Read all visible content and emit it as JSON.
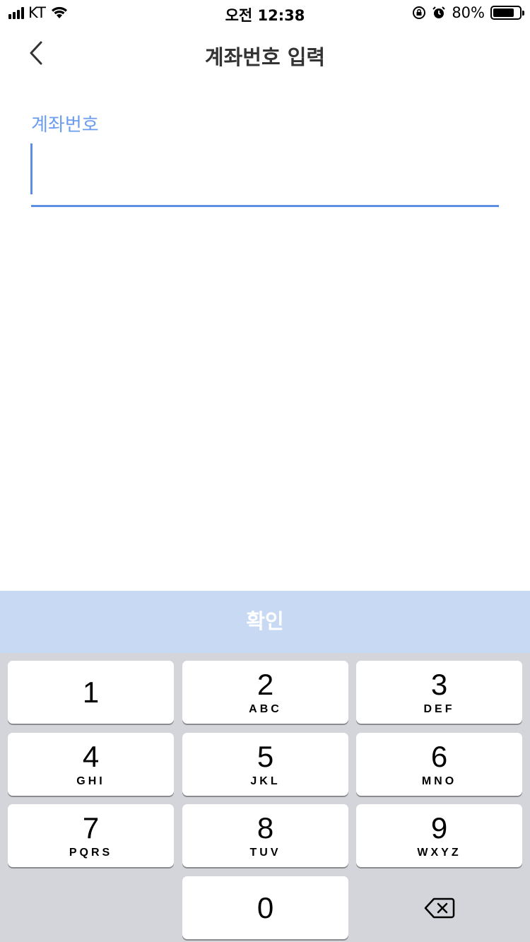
{
  "status_bar": {
    "carrier": "KT",
    "time": "오전 12:38",
    "battery_percent": "80%",
    "battery_level": 0.8,
    "icons": [
      "signal-icon",
      "wifi-icon",
      "orientation-lock-icon",
      "alarm-icon",
      "battery-icon"
    ]
  },
  "nav": {
    "title": "계좌번호 입력",
    "back_icon": "chevron-left-icon"
  },
  "form": {
    "label": "계좌번호",
    "value": "",
    "placeholder": ""
  },
  "confirm": {
    "label": "확인"
  },
  "keypad": {
    "keys": [
      {
        "num": "1",
        "letters": ""
      },
      {
        "num": "2",
        "letters": "ABC"
      },
      {
        "num": "3",
        "letters": "DEF"
      },
      {
        "num": "4",
        "letters": "GHI"
      },
      {
        "num": "5",
        "letters": "JKL"
      },
      {
        "num": "6",
        "letters": "MNO"
      },
      {
        "num": "7",
        "letters": "PQRS"
      },
      {
        "num": "8",
        "letters": "TUV"
      },
      {
        "num": "9",
        "letters": "WXYZ"
      },
      {
        "num": "0",
        "letters": ""
      }
    ],
    "delete_icon": "backspace-icon"
  },
  "colors": {
    "accent": "#5b8fe6",
    "label": "#6b9df0",
    "confirm_bg": "#c7d9f3",
    "keypad_bg": "#d3d5da"
  }
}
